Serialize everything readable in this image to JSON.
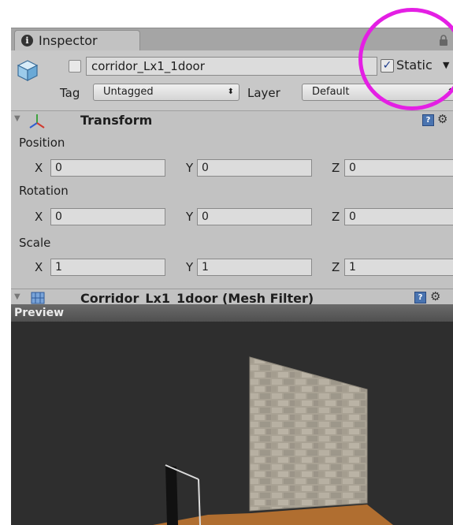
{
  "inspector": {
    "tab_label": "Inspector",
    "tab_icon": "info-icon",
    "lock_icon": "lock-icon"
  },
  "gameobject": {
    "name": "corridor_Lx1_1door",
    "active": false,
    "static_checked": true,
    "static_label": "Static",
    "tag_label": "Tag",
    "tag_value": "Untagged",
    "layer_label": "Layer",
    "layer_value": "Default"
  },
  "transform": {
    "title": "Transform",
    "position": {
      "label": "Position",
      "x_label": "X",
      "x": "0",
      "y_label": "Y",
      "y": "0",
      "z_label": "Z",
      "z": "0"
    },
    "rotation": {
      "label": "Rotation",
      "x_label": "X",
      "x": "0",
      "y_label": "Y",
      "y": "0",
      "z_label": "Z",
      "z": "0"
    },
    "scale": {
      "label": "Scale",
      "x_label": "X",
      "x": "1",
      "y_label": "Y",
      "y": "1",
      "z_label": "Z",
      "z": "1"
    }
  },
  "mesh_filter": {
    "title": "Corridor_Lx1_1door (Mesh Filter)"
  },
  "preview": {
    "label": "Preview"
  },
  "annotation": {
    "highlight_color": "#e41fe4"
  },
  "colors": {
    "panel_bg": "#c2c2c2",
    "preview_bg": "#2e2e2e",
    "floor": "#b06e30",
    "wall": "#a9a294"
  }
}
